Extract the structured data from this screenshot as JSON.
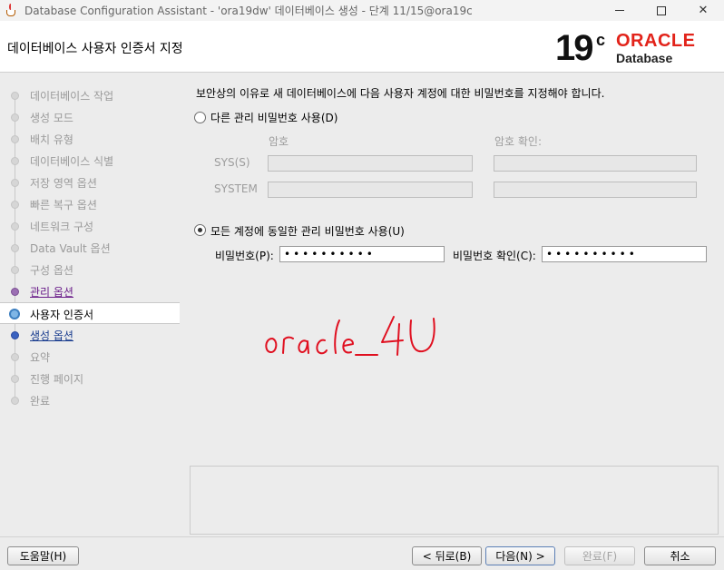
{
  "window": {
    "title": "Database Configuration Assistant - 'ora19dw' 데이터베이스 생성 - 단계 11/15@ora19c",
    "minimize": "—",
    "maximize": "□",
    "close": "✕"
  },
  "header": {
    "page_title": "데이터베이스 사용자 인증서 지정",
    "brand_version": "19",
    "brand_suffix": "c",
    "brand_name": "ORACLE",
    "brand_product": "Database"
  },
  "nav": {
    "items": [
      {
        "label": "데이터베이스 작업",
        "state": "done"
      },
      {
        "label": "생성 모드",
        "state": "done"
      },
      {
        "label": "배치 유형",
        "state": "done"
      },
      {
        "label": "데이터베이스 식별",
        "state": "done"
      },
      {
        "label": "저장 영역 옵션",
        "state": "done"
      },
      {
        "label": "빠른 복구 옵션",
        "state": "done"
      },
      {
        "label": "네트워크 구성",
        "state": "done"
      },
      {
        "label": "Data Vault 옵션",
        "state": "done"
      },
      {
        "label": "구성 옵션",
        "state": "done"
      },
      {
        "label": "관리 옵션",
        "state": "link"
      },
      {
        "label": "사용자 인증서",
        "state": "current"
      },
      {
        "label": "생성 옵션",
        "state": "next"
      },
      {
        "label": "요약",
        "state": "todo"
      },
      {
        "label": "진행 페이지",
        "state": "todo"
      },
      {
        "label": "완료",
        "state": "todo"
      }
    ]
  },
  "main": {
    "intro": "보안상의 이유로 새 데이터베이스에 다음 사용자 계정에 대한 비밀번호를 지정해야 합니다.",
    "option_separate": "다른 관리 비밀번호 사용(D)",
    "col_password": "암호",
    "col_confirm": "암호 확인:",
    "row_sys": "SYS(S)",
    "row_system": "SYSTEM",
    "option_same": "모든 계정에 동일한 관리 비밀번호 사용(U)",
    "password_label": "비밀번호(P):",
    "password_value": "••••••••••",
    "confirm_label": "비밀번호 확인(C):",
    "confirm_value": "••••••••••",
    "annotation": "oracle_4U"
  },
  "buttons": {
    "help": "도움말(H)",
    "back": "< 뒤로(B)",
    "next": "다음(N) >",
    "finish": "완료(F)",
    "cancel": "취소"
  }
}
